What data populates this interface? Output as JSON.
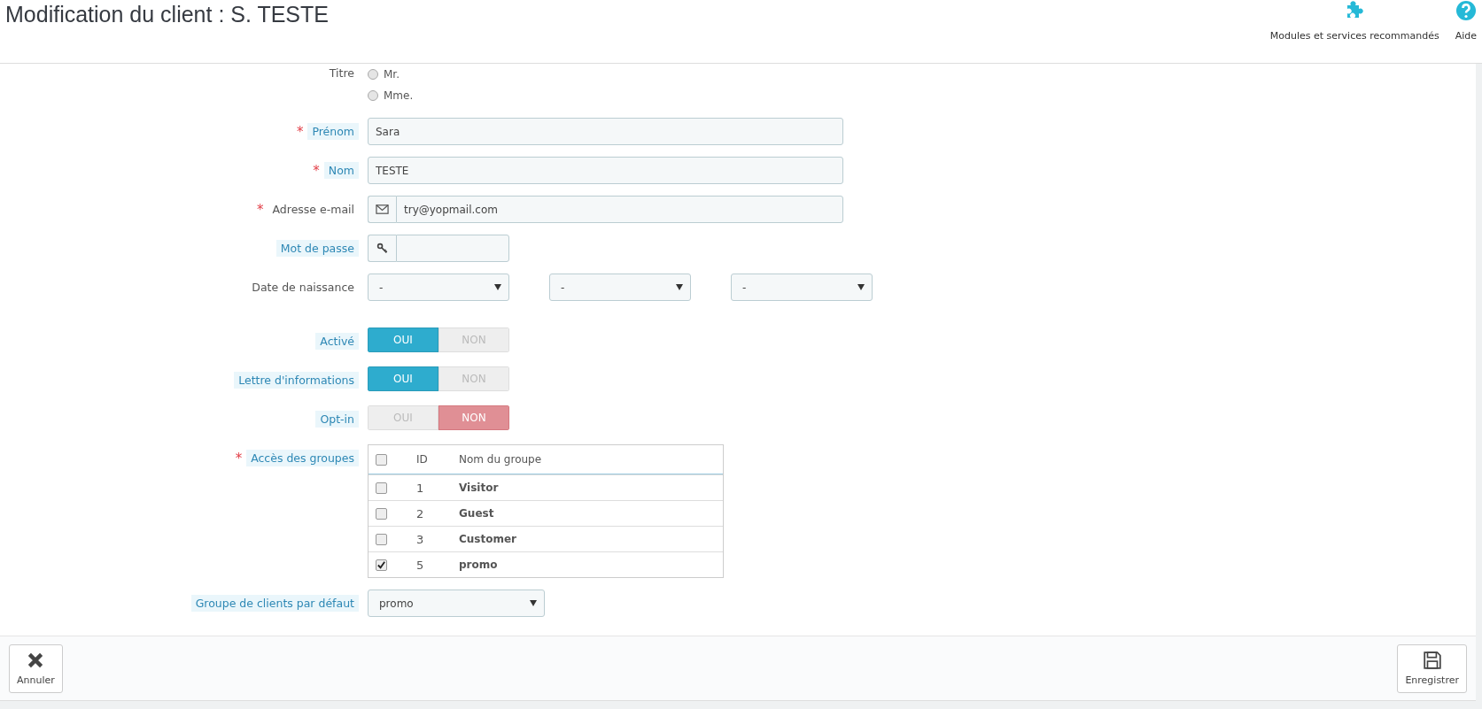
{
  "header": {
    "title": "Modification du client : S. TESTE",
    "actions": [
      {
        "label": "Modules et services recommandés"
      },
      {
        "label": "Aide"
      }
    ]
  },
  "form": [
    {
      "kind": "radio",
      "label": "Titre",
      "hint": false,
      "options": [
        {
          "label": "Mr.",
          "selected": false
        },
        {
          "label": "Mme.",
          "selected": false
        }
      ]
    },
    {
      "kind": "text",
      "label": "Prénom",
      "required_mark": "*",
      "hint": true,
      "value": "Sara"
    },
    {
      "kind": "text",
      "label": "Nom",
      "required_mark": "*",
      "hint": true,
      "value": "TESTE"
    },
    {
      "kind": "email",
      "label": "Adresse e-mail",
      "required_mark": "*",
      "hint": false,
      "value": "try@yopmail.com"
    },
    {
      "kind": "password",
      "label": "Mot de passe",
      "hint": true
    },
    {
      "kind": "date",
      "label": "Date de naissance",
      "hint": false,
      "selects": [
        "-",
        "-",
        "-"
      ]
    },
    {
      "kind": "toggle",
      "label": "Activé",
      "hint": true,
      "options": [
        {
          "label": "OUI",
          "selected": true
        },
        {
          "label": "NON",
          "selected": false
        }
      ]
    },
    {
      "kind": "toggle",
      "label": "Lettre d'informations",
      "hint": true,
      "options": [
        {
          "label": "OUI",
          "selected": true
        },
        {
          "label": "NON",
          "selected": false
        }
      ]
    },
    {
      "kind": "toggle",
      "label": "Opt-in",
      "hint": true,
      "options": [
        {
          "label": "OUI",
          "selected": false
        },
        {
          "label": "NON",
          "selected": true
        }
      ]
    },
    {
      "kind": "groups",
      "label": "Accès des groupes",
      "required_mark": "*",
      "hint": true,
      "all_checked": false,
      "columns": [
        "ID",
        "Nom du groupe"
      ],
      "rows": [
        {
          "id": "1",
          "name": "Visitor",
          "checked": false
        },
        {
          "id": "2",
          "name": "Guest",
          "checked": false
        },
        {
          "id": "3",
          "name": "Customer",
          "checked": false
        },
        {
          "id": "5",
          "name": "promo",
          "checked": true
        }
      ]
    },
    {
      "kind": "select",
      "label": "Groupe de clients par défaut",
      "hint": true,
      "value": "promo"
    }
  ],
  "footer": [
    {
      "label": "Annuler"
    },
    {
      "label": "Enregistrer"
    }
  ]
}
